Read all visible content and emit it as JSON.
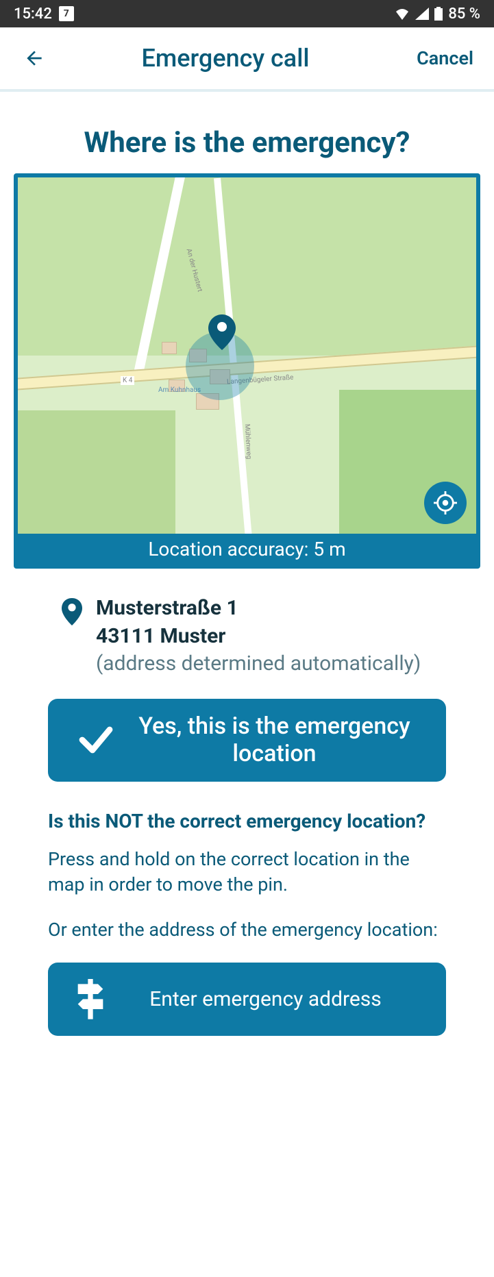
{
  "status_bar": {
    "time": "15:42",
    "calendar_day": "7",
    "battery": "85 %"
  },
  "app_bar": {
    "title": "Emergency call",
    "cancel": "Cancel"
  },
  "heading": "Where is the emergency?",
  "map": {
    "accuracy_label": "Location accuracy: 5 m",
    "road_label_k4": "K 4",
    "street1": "An der Hustert",
    "street2": "Langenbügeler Straße",
    "street3": "Mühlenweg",
    "place1": "Am Kuhnhaus"
  },
  "address": {
    "line1": "Musterstraße 1",
    "line2": "43111 Muster",
    "note": "(address determined automatically)"
  },
  "confirm_button": "Yes, this is the emergency location",
  "alt_section": {
    "heading": "Is this NOT the correct emergency location?",
    "instruction": "Press and hold on the correct location in the map in order to move the pin.",
    "or_text": "Or enter the address of the emergency location:"
  },
  "enter_button": "Enter emergency address"
}
